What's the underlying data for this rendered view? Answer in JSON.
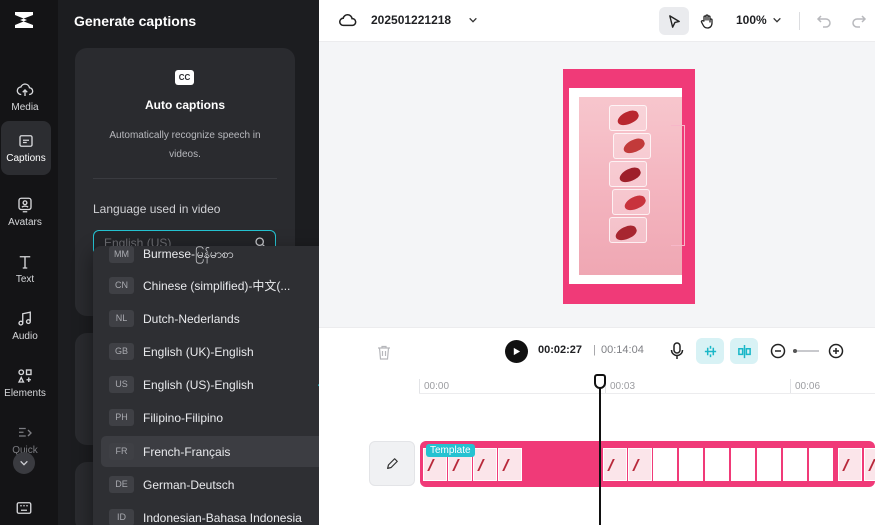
{
  "rail": {
    "items": [
      {
        "label": "Media",
        "icon": "cloud-upload-icon"
      },
      {
        "label": "Captions",
        "icon": "captions-icon",
        "active": true
      },
      {
        "label": "Avatars",
        "icon": "avatar-icon"
      },
      {
        "label": "Text",
        "icon": "text-icon"
      },
      {
        "label": "Audio",
        "icon": "music-note-icon"
      },
      {
        "label": "Elements",
        "icon": "elements-icon"
      },
      {
        "label": "Quick",
        "icon": "quick-icon"
      }
    ]
  },
  "panel": {
    "title": "Generate captions",
    "auto_captions": {
      "icon_text": "CC",
      "title": "Auto captions",
      "description": "Automatically recognize speech in videos.",
      "language_label": "Language used in video",
      "language_placeholder": "English (US)"
    }
  },
  "dropdown": {
    "options": [
      {
        "code": "MM",
        "label": "Burmese-မြန်မာစာ",
        "selected": false,
        "highlighted": false
      },
      {
        "code": "CN",
        "label": "Chinese (simplified)-中文(...",
        "selected": false,
        "highlighted": false
      },
      {
        "code": "NL",
        "label": "Dutch-Nederlands",
        "selected": false,
        "highlighted": false
      },
      {
        "code": "GB",
        "label": "English (UK)-English",
        "selected": false,
        "highlighted": false
      },
      {
        "code": "US",
        "label": "English (US)-English",
        "selected": true,
        "highlighted": false
      },
      {
        "code": "PH",
        "label": "Filipino-Filipino",
        "selected": false,
        "highlighted": false
      },
      {
        "code": "FR",
        "label": "French-Français",
        "selected": false,
        "highlighted": true
      },
      {
        "code": "DE",
        "label": "German-Deutsch",
        "selected": false,
        "highlighted": false
      },
      {
        "code": "ID",
        "label": "Indonesian-Bahasa Indonesia",
        "selected": false,
        "highlighted": false
      }
    ]
  },
  "topbar": {
    "project_name": "202501221218",
    "zoom": "100%"
  },
  "timeline": {
    "current_time": "00:02:27",
    "separator": "|",
    "total_time": "00:14:04",
    "ruler": [
      "00:00",
      "00:03",
      "00:06"
    ],
    "track_tag": "Template"
  },
  "colors": {
    "accent": "#25c2d1",
    "brand_pink": "#f03a78",
    "dark_panel": "#1c1d20"
  }
}
